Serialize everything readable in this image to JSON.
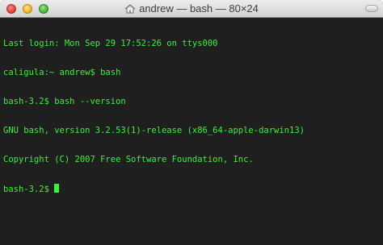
{
  "window": {
    "title": "andrew — bash — 80×24",
    "buttons": [
      "close-icon",
      "minimize-icon",
      "zoom-icon"
    ],
    "title_icon": "home-icon"
  },
  "terminal": {
    "text_color": "#3cf03c",
    "background": "#1f1f1f",
    "lines": [
      "Last login: Mon Sep 29 17:52:26 on ttys000",
      "caligula:~ andrew$ bash",
      "bash-3.2$ bash --version",
      "GNU bash, version 3.2.53(1)-release (x86_64-apple-darwin13)",
      "Copyright (C) 2007 Free Software Foundation, Inc.",
      "bash-3.2$ "
    ]
  }
}
